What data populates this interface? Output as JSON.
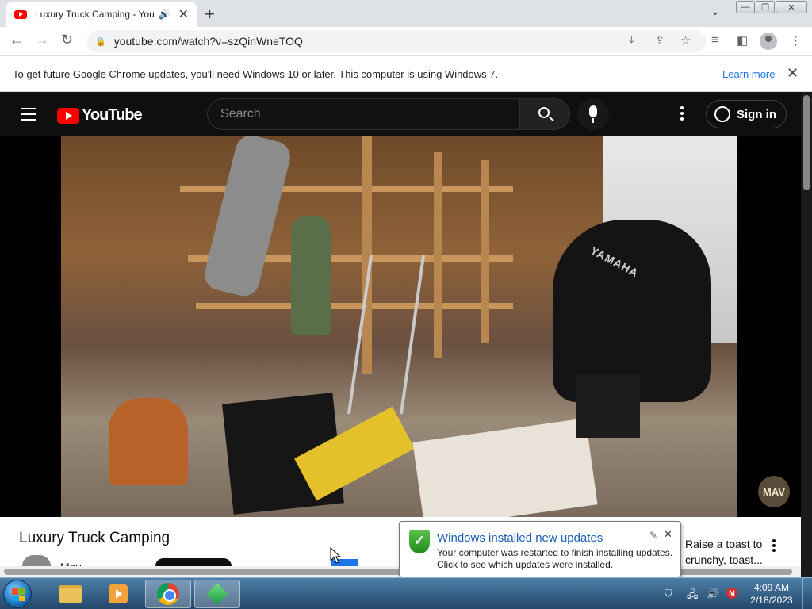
{
  "browser": {
    "tab": {
      "title": "Luxury Truck Camping - YouTube"
    },
    "url": "youtube.com/watch?v=szQinWneTOQ"
  },
  "infobar": {
    "message": "To get future Google Chrome updates, you'll need Windows 10 or later. This computer is using Windows 7.",
    "learn_more": "Learn more"
  },
  "youtube": {
    "logo_text": "YouTube",
    "search_placeholder": "Search",
    "sign_in": "Sign in",
    "channel_watermark": "MAV"
  },
  "video": {
    "title": "Luxury Truck Camping",
    "channel": "Mav",
    "motor_brand": "YAMAHA"
  },
  "recommendation": {
    "text": "Raise a toast to crunchy, toast..."
  },
  "notification": {
    "title": "Windows installed new updates",
    "line1": "Your computer was restarted to finish installing updates.",
    "line2": "Click to see which updates were installed."
  },
  "taskbar": {
    "time": "4:09 AM",
    "date": "2/18/2023",
    "apps": [
      "windows-explorer",
      "media-center",
      "google-chrome",
      "3d-builder"
    ]
  },
  "colors": {
    "youtube_red": "#ff0000",
    "link_blue": "#1a73e8",
    "yt_background": "#0f0f0f"
  }
}
